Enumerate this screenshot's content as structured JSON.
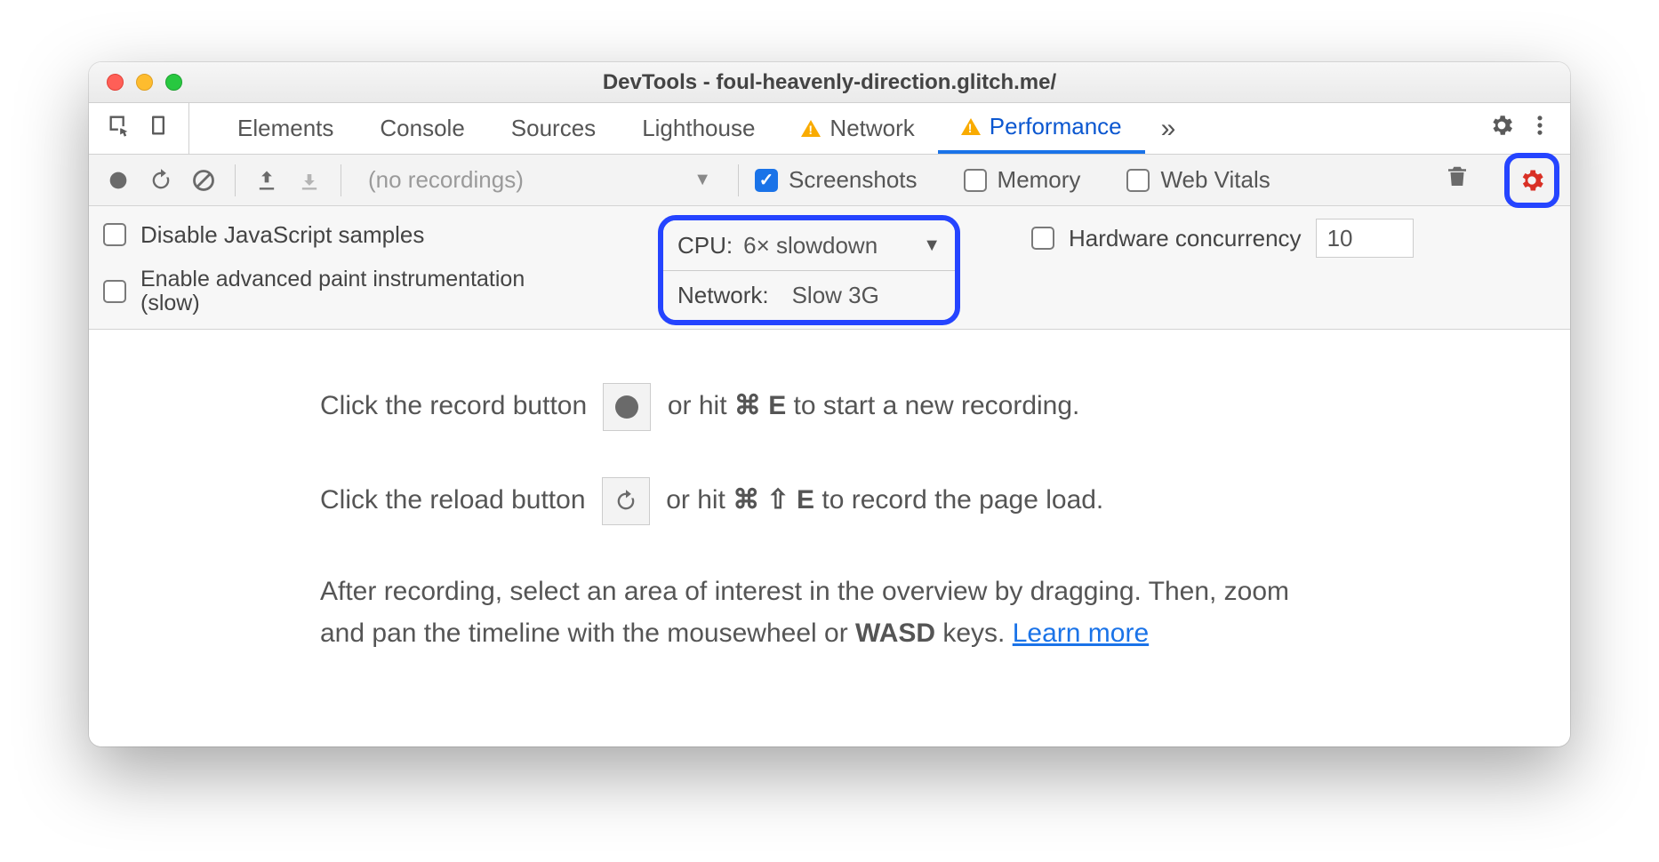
{
  "window": {
    "title": "DevTools - foul-heavenly-direction.glitch.me/"
  },
  "tabs": {
    "items": [
      "Elements",
      "Console",
      "Sources",
      "Lighthouse",
      "Network",
      "Performance"
    ],
    "active": "Performance",
    "warning_tabs": [
      "Network",
      "Performance"
    ],
    "more_symbol": "»"
  },
  "toolbar": {
    "recordings_placeholder": "(no recordings)",
    "checkboxes": {
      "screenshots": {
        "label": "Screenshots",
        "checked": true
      },
      "memory": {
        "label": "Memory",
        "checked": false
      },
      "webvitals": {
        "label": "Web Vitals",
        "checked": false
      }
    }
  },
  "settings": {
    "disable_js": {
      "label": "Disable JavaScript samples",
      "checked": false
    },
    "adv_paint_line1": "Enable advanced paint instrumentation",
    "adv_paint_line2": "(slow)",
    "adv_paint_checked": false,
    "cpu_label": "CPU:",
    "cpu_value": "6× slowdown",
    "network_label": "Network:",
    "network_value": "Slow 3G",
    "hw_label": "Hardware concurrency",
    "hw_checked": false,
    "hw_value": "10"
  },
  "content": {
    "line1a": "Click the record button ",
    "line1b": " or hit ",
    "line1c": " to start a new recording.",
    "shortcut1": "⌘ E",
    "line2a": "Click the reload button ",
    "line2b": " or hit ",
    "line2c": " to record the page load.",
    "shortcut2": "⌘ ⇧ E",
    "line3a": "After recording, select an area of interest in the overview by dragging. Then, zoom and pan the timeline with the mousewheel or ",
    "wasd": "WASD",
    "line3b": " keys. ",
    "learn_more": "Learn more"
  }
}
